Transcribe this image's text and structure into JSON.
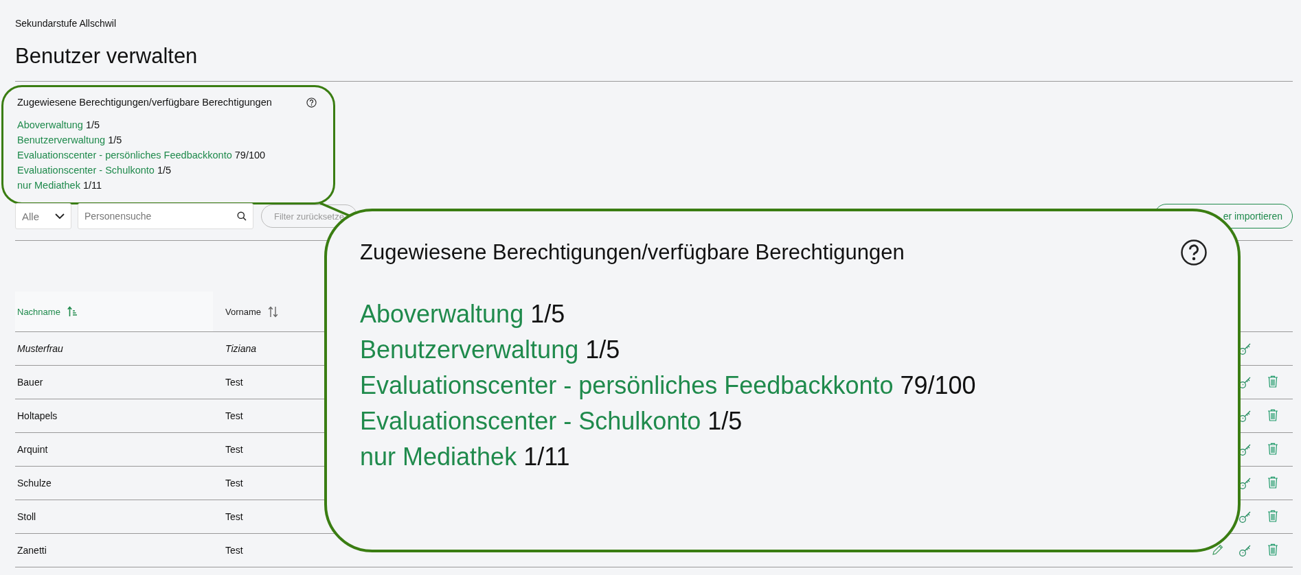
{
  "organization": "Sekundarstufe Allschwil",
  "page_title": "Benutzer verwalten",
  "permissions": {
    "heading": "Zugewiesene Berechtigungen/verfügbare Berechtigungen",
    "items": [
      {
        "name": "Aboverwaltung",
        "count": "1/5"
      },
      {
        "name": "Benutzerverwaltung",
        "count": "1/5"
      },
      {
        "name": "Evaluationscenter - persönliches Feedbackkonto",
        "count": "79/100"
      },
      {
        "name": "Evaluationscenter - Schulkonto",
        "count": "1/5"
      },
      {
        "name": "nur Mediathek",
        "count": "1/11"
      }
    ]
  },
  "toolbar": {
    "role_filter": {
      "value": "Alle"
    },
    "search": {
      "placeholder": "Personensuche"
    },
    "reset_button": "Filter zurücksetze",
    "import_button": "er importieren"
  },
  "table": {
    "columns": [
      {
        "label": "Nachname",
        "sorted": true
      },
      {
        "label": "Vorname",
        "sorted": false
      }
    ],
    "rows": [
      {
        "last_name": "Musterfrau",
        "first_name": "Tiziana",
        "italic": true,
        "editable": false,
        "deletable": false
      },
      {
        "last_name": "Bauer",
        "first_name": "Test",
        "italic": false,
        "editable": false,
        "deletable": true
      },
      {
        "last_name": "Holtapels",
        "first_name": "Test",
        "italic": false,
        "editable": false,
        "deletable": true
      },
      {
        "last_name": "Arquint",
        "first_name": "Test",
        "italic": false,
        "editable": false,
        "deletable": true
      },
      {
        "last_name": "Schulze",
        "first_name": "Test",
        "italic": false,
        "editable": false,
        "deletable": true
      },
      {
        "last_name": "Stoll",
        "first_name": "Test",
        "italic": false,
        "editable": false,
        "deletable": true
      },
      {
        "last_name": "Zanetti",
        "first_name": "Test",
        "italic": false,
        "editable": true,
        "deletable": true
      }
    ]
  },
  "magnified_callout": {
    "heading": "Zugewiesene Berechtigungen/verfügbare Berechtigungen",
    "items": [
      {
        "name": "Aboverwaltung",
        "count": "1/5"
      },
      {
        "name": "Benutzerverwaltung",
        "count": "1/5"
      },
      {
        "name": "Evaluationscenter - persönliches Feedbackkonto",
        "count": "79/100"
      },
      {
        "name": "Evaluationscenter - Schulkonto",
        "count": "1/5"
      },
      {
        "name": "nur Mediathek",
        "count": "1/11"
      }
    ]
  }
}
